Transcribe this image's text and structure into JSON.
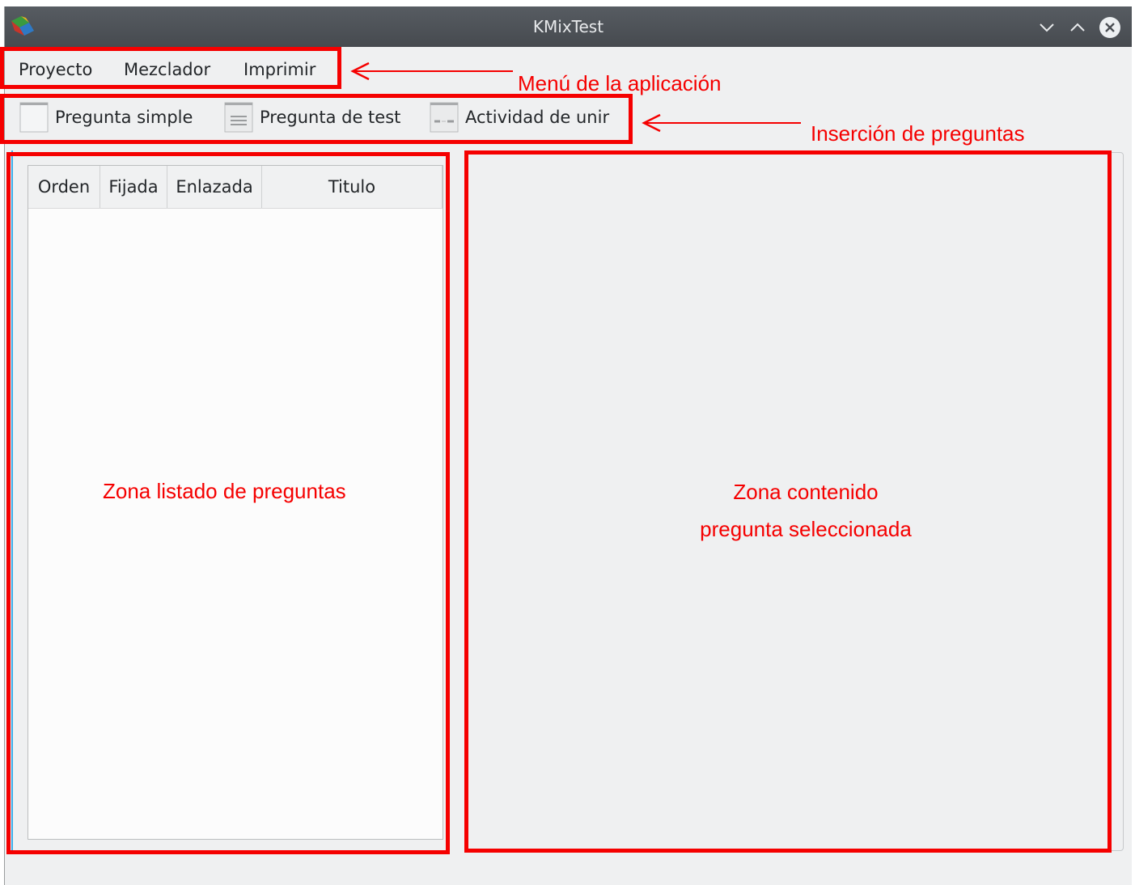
{
  "window": {
    "title": "KMixTest",
    "controls": [
      "chevron-down-icon",
      "chevron-up-icon",
      "close-icon"
    ]
  },
  "menubar": {
    "items": [
      {
        "label": "Proyecto"
      },
      {
        "label": "Mezclador"
      },
      {
        "label": "Imprimir"
      }
    ]
  },
  "toolbar": {
    "items": [
      {
        "label": "Pregunta simple",
        "icon": "blank-page-icon"
      },
      {
        "label": "Pregunta de test",
        "icon": "lined-page-icon"
      },
      {
        "label": "Actividad de unir",
        "icon": "match-page-icon"
      }
    ]
  },
  "question_table": {
    "columns": [
      "Orden",
      "Fijada",
      "Enlazada",
      "Titulo"
    ],
    "rows": []
  },
  "annotations": {
    "menu": "Menú de la aplicación",
    "insertion": "Inserción de preguntas",
    "list_zone": "Zona listado de preguntas",
    "content_zone_line1": "Zona contenido",
    "content_zone_line2": "pregunta seleccionada"
  },
  "colors": {
    "annotation_red": "#f50000",
    "titlebar": "#4f5358",
    "window_bg": "#eff0f1",
    "focus_accent": "#3daee9"
  }
}
